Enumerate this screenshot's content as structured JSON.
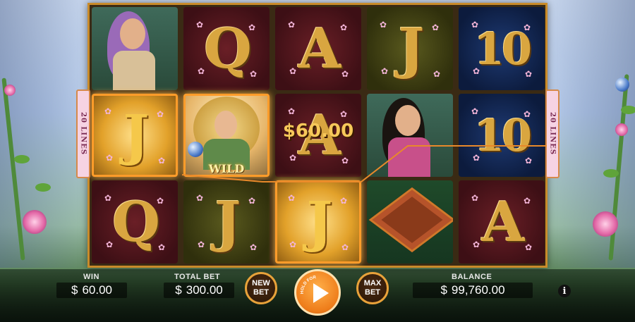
{
  "reels": [
    [
      {
        "type": "character",
        "name": "fairy-purple-hair"
      },
      {
        "type": "letter",
        "symbol": "J",
        "theme": "gold",
        "win": true
      },
      {
        "type": "letter",
        "symbol": "Q",
        "theme": "maroon"
      }
    ],
    [
      {
        "type": "letter",
        "symbol": "Q",
        "theme": "maroon"
      },
      {
        "type": "wild",
        "label": "WILD",
        "win": true
      },
      {
        "type": "letter",
        "symbol": "J",
        "theme": "olive"
      }
    ],
    [
      {
        "type": "letter",
        "symbol": "A",
        "theme": "maroon"
      },
      {
        "type": "letter",
        "symbol": "A",
        "theme": "maroon",
        "win_amount": "$60.00"
      },
      {
        "type": "letter",
        "symbol": "J",
        "theme": "gold",
        "win": true
      }
    ],
    [
      {
        "type": "letter",
        "symbol": "J",
        "theme": "olive"
      },
      {
        "type": "character",
        "name": "fairy-dark-hair"
      },
      {
        "type": "scatter",
        "name": "magic-box"
      }
    ],
    [
      {
        "type": "letter",
        "symbol": "10",
        "theme": "navy"
      },
      {
        "type": "letter",
        "symbol": "10",
        "theme": "navy"
      },
      {
        "type": "letter",
        "symbol": "A",
        "theme": "maroon"
      }
    ]
  ],
  "lines_badge": {
    "left": "20 LINES",
    "right": "20 LINES"
  },
  "controls": {
    "win_label": "WIN",
    "win_currency": "$",
    "win_value": "60.00",
    "total_bet_label": "TOTAL BET",
    "total_bet_currency": "$",
    "total_bet_value": "300.00",
    "new_bet_label": "NEW BET",
    "spin_hint": "HOLD FOR AUTOSPIN",
    "max_bet_label": "MAX BET",
    "balance_label": "BALANCE",
    "balance_currency": "$",
    "balance_value": "99,760.00",
    "info_label": "i"
  },
  "colors": {
    "frame": "#c98b2a",
    "payline": "#e8892a",
    "spin": "#ee7c1a",
    "gold_symbol": "#d9a640"
  }
}
